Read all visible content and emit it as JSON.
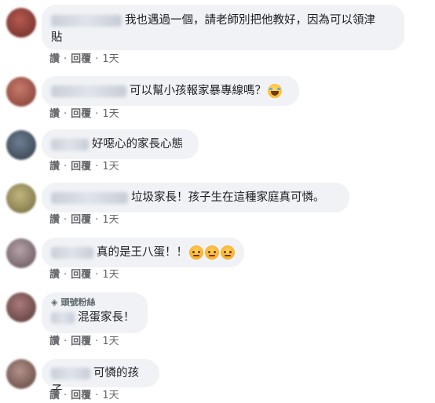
{
  "comments": [
    {
      "text": "我也遇過一個，請老師別把他教好，因為可以領津貼",
      "line1": "我也遇過一個，請老師別把他教好，因為可以領津",
      "line2": "貼",
      "like": "讚",
      "reply": "回覆",
      "time": "1天",
      "avatar_color": "#8a3b35"
    },
    {
      "text": "可以幫小孩報家暴專線嗎？",
      "like": "讚",
      "reply": "回覆",
      "time": "1天",
      "emoji": "laughing-with-tears-icon",
      "avatar_color": "#a45a4e"
    },
    {
      "text": "好噁心的家長心態",
      "like": "讚",
      "reply": "回覆",
      "time": "1天",
      "avatar_color": "#4f5d6e"
    },
    {
      "text": "垃圾家長！孩子生在這種家庭真可憐。",
      "like": "讚",
      "reply": "回覆",
      "time": "1天",
      "avatar_color": "#9a8f5c"
    },
    {
      "text": "真的是王八蛋！！",
      "like": "讚",
      "reply": "回覆",
      "time": "1天",
      "emoji": "angry-face-icon",
      "avatar_color": "#8f7a80"
    },
    {
      "badge": "頭號粉絲",
      "text": "混蛋家長！",
      "like": "讚",
      "reply": "回覆",
      "time": "1天",
      "avatar_color": "#7d5a5a"
    },
    {
      "text": "可憐的孩子",
      "like": "讚",
      "reply": "回覆",
      "time": "1天",
      "avatar_color": "#8b6e62"
    }
  ],
  "colors": {
    "bubble": "#f0f2f5",
    "text": "#1c1e21",
    "meta": "#65676b"
  }
}
